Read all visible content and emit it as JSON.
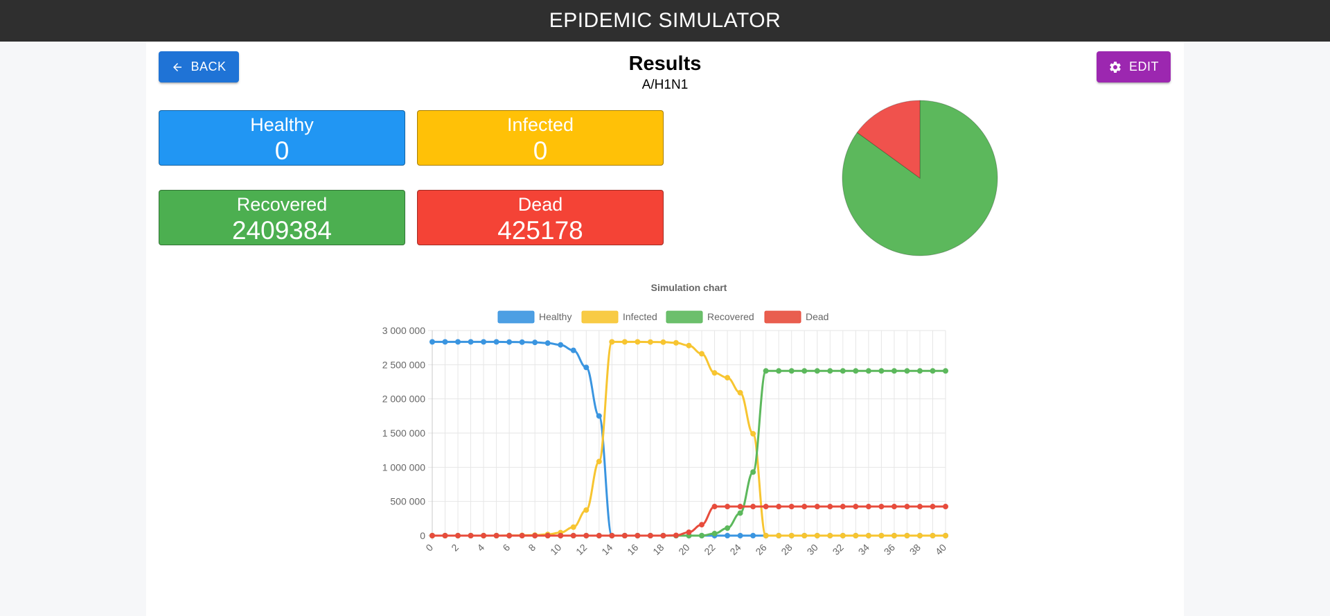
{
  "app": {
    "title": "EPIDEMIC SIMULATOR"
  },
  "header": {
    "back_label": "BACK",
    "edit_label": "EDIT",
    "title": "Results",
    "subtitle": "A/H1N1"
  },
  "stats": {
    "healthy": {
      "label": "Healthy",
      "value": "0",
      "color": "#2196f3"
    },
    "infected": {
      "label": "Infected",
      "value": "0",
      "color": "#ffc107"
    },
    "recovered": {
      "label": "Recovered",
      "value": "2409384",
      "color": "#4caf50"
    },
    "dead": {
      "label": "Dead",
      "value": "425178",
      "color": "#f44336"
    }
  },
  "chart_data": [
    {
      "type": "pie",
      "categories": [
        "Healthy",
        "Infected",
        "Recovered",
        "Dead"
      ],
      "values": [
        0,
        0,
        2409384,
        425178
      ],
      "colors": [
        "#2196f3",
        "#ffc107",
        "#5cb85c",
        "#f0524d"
      ]
    },
    {
      "type": "line",
      "title": "Simulation chart",
      "legend_position": "top",
      "grid": true,
      "x": [
        0,
        1,
        2,
        3,
        4,
        5,
        6,
        7,
        8,
        9,
        10,
        11,
        12,
        13,
        14,
        15,
        16,
        17,
        18,
        19,
        20,
        21,
        22,
        23,
        24,
        25,
        26,
        27,
        28,
        29,
        30,
        31,
        32,
        33,
        34,
        35,
        36,
        37,
        38,
        39,
        40
      ],
      "x_tick_labels": [
        "0",
        "2",
        "4",
        "6",
        "8",
        "10",
        "12",
        "14",
        "16",
        "18",
        "20",
        "22",
        "24",
        "26",
        "28",
        "30",
        "32",
        "34",
        "36",
        "38",
        "40"
      ],
      "y_tick_labels": [
        "0",
        "500 000",
        "1 000 000",
        "1 500 000",
        "2 000 000",
        "2 500 000",
        "3 000 000"
      ],
      "ylim": [
        0,
        3000000
      ],
      "series": [
        {
          "name": "Healthy",
          "color": "#3a95e0",
          "values": [
            2834000,
            2834000,
            2834000,
            2834000,
            2834000,
            2834000,
            2832000,
            2830000,
            2826000,
            2816000,
            2790000,
            2710000,
            2460000,
            1750000,
            0,
            0,
            0,
            0,
            0,
            0,
            0,
            0,
            0,
            0,
            0,
            0,
            0,
            0,
            0,
            0,
            0,
            0,
            0,
            0,
            0,
            0,
            0,
            0,
            0,
            0,
            0
          ]
        },
        {
          "name": "Infected",
          "color": "#f7c531",
          "values": [
            0,
            0,
            0,
            0,
            0,
            0,
            2000,
            4000,
            8000,
            18000,
            44000,
            124000,
            374000,
            1084000,
            2834000,
            2834000,
            2834000,
            2832000,
            2830000,
            2820000,
            2780000,
            2660000,
            2380000,
            2310000,
            2090000,
            1490000,
            0,
            0,
            0,
            0,
            0,
            0,
            0,
            0,
            0,
            0,
            0,
            0,
            0,
            0,
            0
          ]
        },
        {
          "name": "Recovered",
          "color": "#5cb85c",
          "values": [
            0,
            0,
            0,
            0,
            0,
            0,
            0,
            0,
            0,
            0,
            0,
            0,
            0,
            0,
            0,
            0,
            0,
            0,
            0,
            0,
            0,
            0,
            30000,
            110000,
            330000,
            930000,
            2409384,
            2409384,
            2409384,
            2409384,
            2409384,
            2409384,
            2409384,
            2409384,
            2409384,
            2409384,
            2409384,
            2409384,
            2409384,
            2409384,
            2409384
          ]
        },
        {
          "name": "Dead",
          "color": "#e74c3c",
          "values": [
            0,
            0,
            0,
            0,
            0,
            0,
            0,
            0,
            0,
            0,
            0,
            0,
            0,
            0,
            0,
            0,
            0,
            0,
            0,
            4000,
            50000,
            160000,
            425178,
            425178,
            425178,
            425178,
            425178,
            425178,
            425178,
            425178,
            425178,
            425178,
            425178,
            425178,
            425178,
            425178,
            425178,
            425178,
            425178,
            425178,
            425178
          ]
        }
      ]
    }
  ]
}
